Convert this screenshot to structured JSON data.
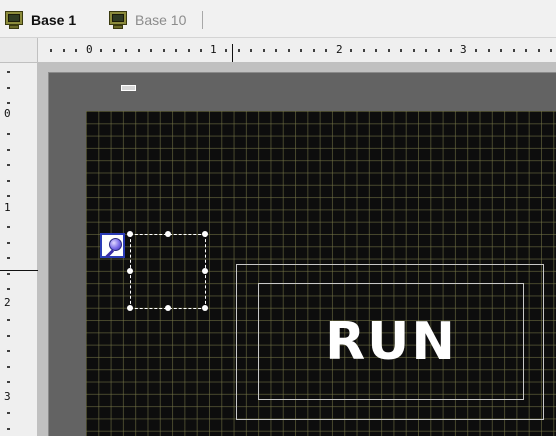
{
  "tabs": [
    {
      "label": "Base 1",
      "icon": "monitor-icon",
      "active": true
    },
    {
      "label": "Base 10",
      "icon": "monitor-icon",
      "active": false
    }
  ],
  "ruler": {
    "horizontal": [
      "0",
      "1",
      "2",
      "3"
    ],
    "vertical": [
      "0",
      "1",
      "2",
      "3"
    ]
  },
  "canvas": {
    "background": "#0d0d0d",
    "grid_color": "#78784a",
    "frame_color": "#636363",
    "lamp": {
      "text": "RUN",
      "text_color": "#ffffff",
      "border_color": "#c8c8c8"
    },
    "selected_object": {
      "handle_color": "#ffffff",
      "handles": 8
    },
    "magnifier_icon": "magnifier-icon"
  }
}
